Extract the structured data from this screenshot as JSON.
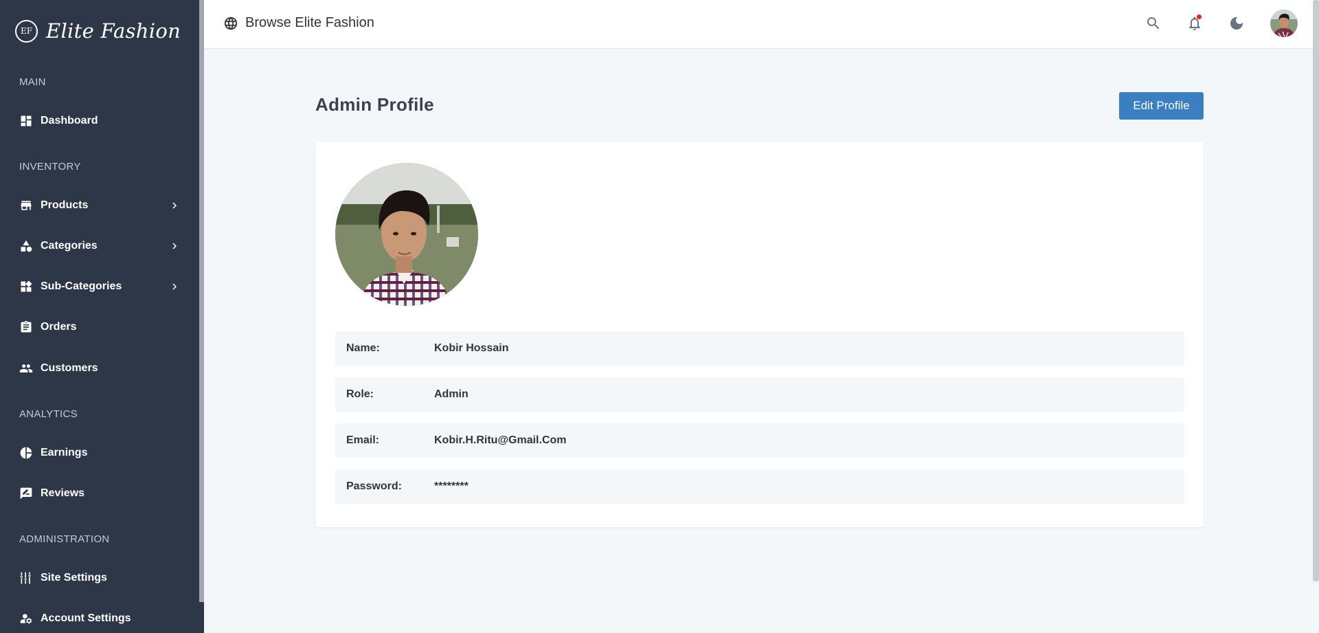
{
  "brand": {
    "name": "Elite Fashion",
    "logo_text": "EF"
  },
  "sidebar": {
    "sections": [
      {
        "title": "MAIN"
      },
      {
        "title": "INVENTORY"
      },
      {
        "title": "ANALYTICS"
      },
      {
        "title": "ADMINISTRATION"
      }
    ],
    "items": [
      {
        "label": "Dashboard",
        "icon": "dashboard-icon"
      },
      {
        "label": "Products",
        "icon": "store-icon",
        "has_submenu": true
      },
      {
        "label": "Categories",
        "icon": "shapes-icon",
        "has_submenu": true
      },
      {
        "label": "Sub-Categories",
        "icon": "widgets-icon",
        "has_submenu": true
      },
      {
        "label": "Orders",
        "icon": "clipboard-icon"
      },
      {
        "label": "Customers",
        "icon": "people-icon"
      },
      {
        "label": "Earnings",
        "icon": "pie-chart-icon"
      },
      {
        "label": "Reviews",
        "icon": "rate-review-icon"
      },
      {
        "label": "Site Settings",
        "icon": "sliders-icon"
      },
      {
        "label": "Account Settings",
        "icon": "manage-account-icon"
      }
    ]
  },
  "header": {
    "browse_label": "Browse Elite Fashion",
    "icons": [
      "search-icon",
      "bell-icon",
      "moon-icon"
    ],
    "has_notification": true
  },
  "main": {
    "title": "Admin Profile",
    "edit_button": "Edit Profile",
    "fields": [
      {
        "key": "Name:",
        "value": "Kobir Hossain"
      },
      {
        "key": "Role:",
        "value": "Admin"
      },
      {
        "key": "Email:",
        "value": "Kobir.H.Ritu@Gmail.Com"
      },
      {
        "key": "Password:",
        "value": "********"
      }
    ]
  },
  "colors": {
    "sidebar_bg": "#2d3748",
    "page_bg": "#f4f7fa",
    "accent": "#3b7fc0",
    "notification": "#e02424"
  }
}
